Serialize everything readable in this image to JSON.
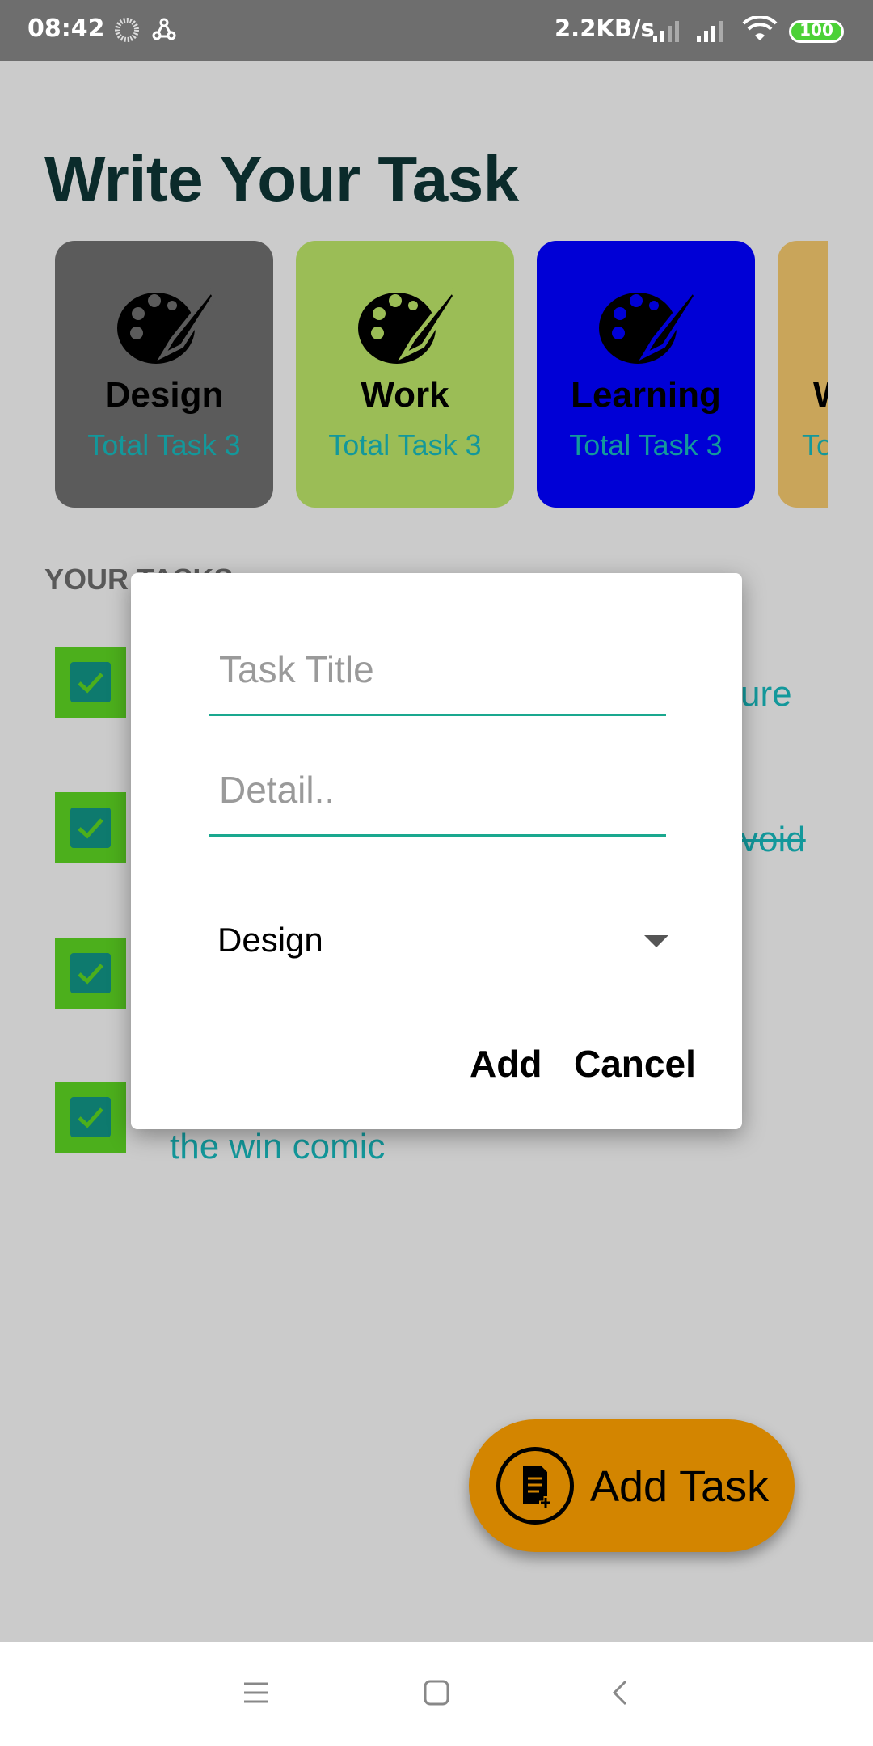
{
  "status": {
    "time": "08:42",
    "speed": "2.2KB/s",
    "battery": "100"
  },
  "app": {
    "title": "Write Your Task",
    "section_label": "YOUR TASKS"
  },
  "categories": [
    {
      "name": "Design",
      "total": "Total Task 3",
      "color": "#5b5b5b",
      "icon": "palette-icon"
    },
    {
      "name": "Work",
      "total": "Total Task 3",
      "color": "#9bbd56",
      "icon": "palette-icon"
    },
    {
      "name": "Learning",
      "total": "Total Task 3",
      "color": "#0000d6",
      "icon": "palette-icon"
    },
    {
      "name": "W",
      "total": "To",
      "color": "#c9a55a",
      "icon": "palette-icon"
    }
  ],
  "tasks": [
    {
      "visible_text": "ure",
      "checked": true,
      "strikethrough": false
    },
    {
      "visible_text": "void",
      "checked": true,
      "strikethrough": true
    },
    {
      "visible_text": "",
      "checked": true,
      "strikethrough": false
    },
    {
      "visible_text": "the win comic",
      "checked": true,
      "strikethrough": false
    }
  ],
  "fab": {
    "label": "Add Task",
    "icon": "add-document-icon"
  },
  "dialog": {
    "title_placeholder": "Task Title",
    "detail_placeholder": "Detail..",
    "category_selected": "Design",
    "add_label": "Add",
    "cancel_label": "Cancel"
  },
  "colors": {
    "accent": "#1aa88f",
    "fab": "#d38500",
    "check": "#4caf1c",
    "task_text": "#13989b"
  }
}
